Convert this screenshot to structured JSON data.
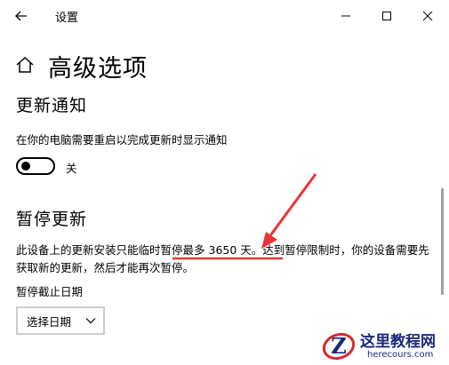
{
  "window": {
    "title": "设置"
  },
  "page": {
    "title": "高级选项"
  },
  "notifications": {
    "heading": "更新通知",
    "description": "在你的电脑需要重启以完成更新时显示通知",
    "toggle_state": "关",
    "toggle_on": false
  },
  "pause": {
    "heading": "暂停更新",
    "description_pre": "此设备上的更新安装只能临时",
    "description_highlight": "暂停最多 3650 天",
    "description_post": "。达到暂停限制时，你的设备需要先获取新的更新，然后才能再次暂停。",
    "date_label": "暂停截止日期",
    "date_select_value": "选择日期"
  },
  "annotation": {
    "color": "#e8343a"
  },
  "watermark": {
    "name": "这里教程网",
    "url": "herecours.com",
    "logo_letter": "Z"
  }
}
